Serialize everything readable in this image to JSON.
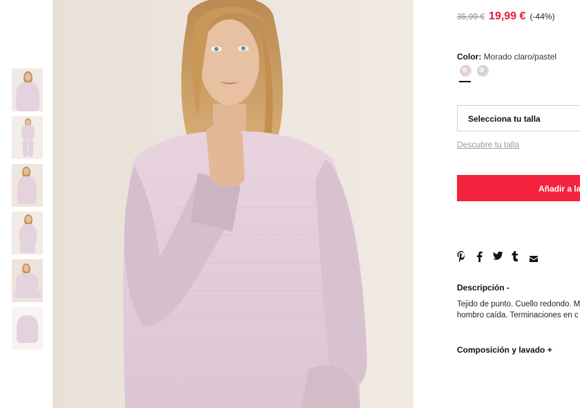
{
  "product": {
    "price_old": "35,99 €",
    "price_new": "19,99 €",
    "discount": "(-44%)"
  },
  "color": {
    "label": "Color:",
    "value": "Morado claro/pastel",
    "swatch_colors": [
      "#e7c8d8",
      "#cfd2cc"
    ]
  },
  "size": {
    "select_label": "Selecciona tu talla",
    "guide_link": "Descubre tu talla"
  },
  "cart": {
    "add_label": "Añadir a la"
  },
  "share": {
    "icons": [
      "pinterest-icon",
      "facebook-icon",
      "twitter-icon",
      "tumblr-icon",
      "mail-icon"
    ]
  },
  "description": {
    "title": "Descripción -",
    "line1": "Tejido de punto. Cuello redondo. M",
    "line2": "hombro caída. Terminaciones en c"
  },
  "composition": {
    "title": "Composición y lavado +"
  },
  "colors": {
    "accent": "#f4233d",
    "sale_price": "#e21b3b"
  }
}
